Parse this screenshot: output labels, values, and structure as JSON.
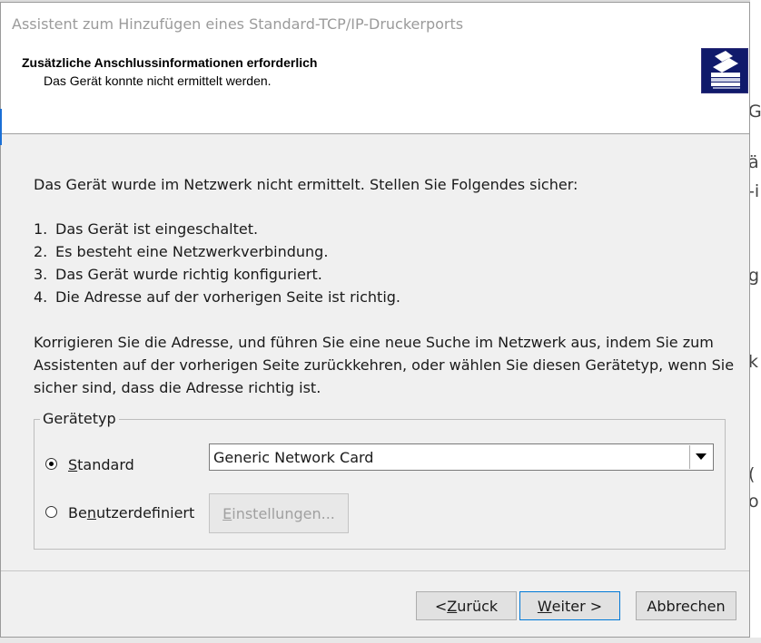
{
  "window": {
    "title": "Assistent zum Hinzufügen eines Standard-TCP/IP-Druckerports"
  },
  "header": {
    "title": "Zusätzliche Anschlussinformationen erforderlich",
    "subtitle": "Das Gerät konnte nicht ermittelt werden.",
    "icon": "printer-icon"
  },
  "body": {
    "intro": "Das Gerät wurde im Netzwerk nicht ermittelt. Stellen Sie Folgendes sicher:",
    "list": [
      {
        "num": "1.",
        "text": "Das Gerät ist eingeschaltet."
      },
      {
        "num": "2.",
        "text": "Es besteht eine Netzwerkverbindung."
      },
      {
        "num": "3.",
        "text": "Das Gerät wurde richtig konfiguriert."
      },
      {
        "num": "4.",
        "text": "Die Adresse auf der vorherigen Seite ist richtig."
      }
    ],
    "paragraph_lines": [
      "Korrigieren Sie die Adresse, und führen Sie eine neue Suche im Netzwerk aus, indem Sie zum",
      "Assistenten auf der vorherigen Seite zurückkehren, oder wählen Sie diesen Gerätetyp, wenn Sie",
      "sicher sind, dass die Adresse richtig ist."
    ]
  },
  "device_type": {
    "group_label": "Gerätetyp",
    "standard": {
      "label_first": "S",
      "label_rest": "tandard",
      "selected": true
    },
    "custom": {
      "label_first": "Be",
      "label_u": "n",
      "label_rest": "utzerdefiniert",
      "selected": false
    },
    "select_value": "Generic Network Card",
    "settings_button": {
      "label_u": "E",
      "label_rest": "instellungen..."
    }
  },
  "footer": {
    "back": {
      "prefix": "< ",
      "u": "Z",
      "rest": "urück"
    },
    "next": {
      "u": "W",
      "rest": "eiter >"
    },
    "cancel": "Abbrechen"
  },
  "background_fragments": [
    "G",
    "ä",
    "-i",
    "g",
    "k",
    "(",
    "o"
  ],
  "colors": {
    "header_icon_bg": "#101a6b",
    "accent": "#0078d7",
    "title_text": "#9b9b9b"
  }
}
